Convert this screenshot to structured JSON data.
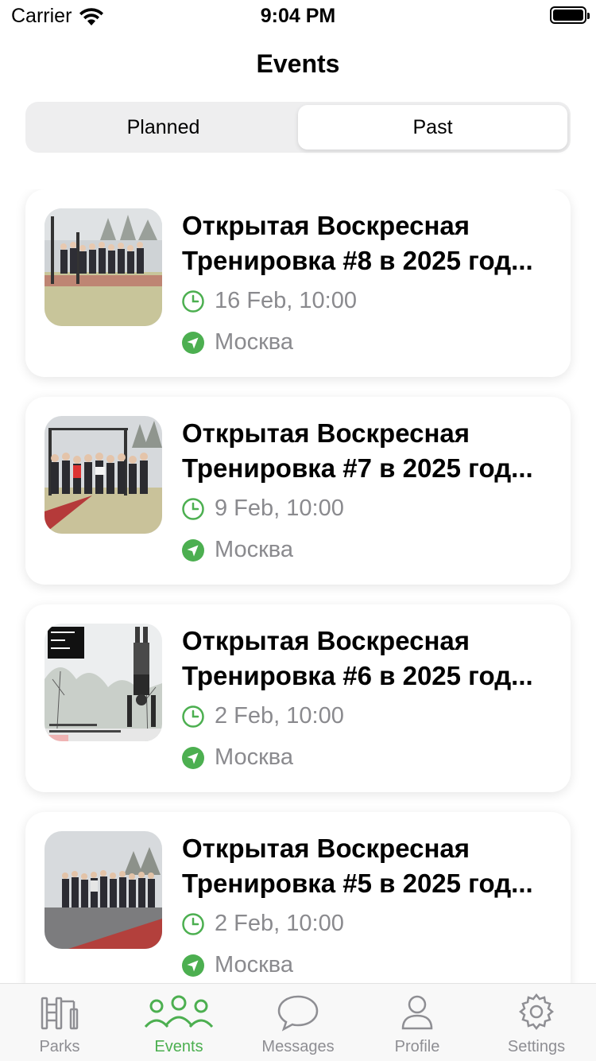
{
  "status_bar": {
    "carrier": "Carrier",
    "time": "9:04 PM"
  },
  "nav": {
    "title": "Events"
  },
  "segmented": {
    "planned": "Planned",
    "past": "Past",
    "selected": "Past"
  },
  "events": [
    {
      "title": "Открытая Воскресная\nТренировка #8 в 2025 год...",
      "date": "16 Feb, 10:00",
      "place": "Москва"
    },
    {
      "title": "Открытая Воскресная\nТренировка #7 в 2025 год...",
      "date": "9 Feb, 10:00",
      "place": "Москва"
    },
    {
      "title": "Открытая Воскресная\nТренировка #6 в 2025 год...",
      "date": "2 Feb, 10:00",
      "place": "Москва"
    },
    {
      "title": "Открытая Воскресная\nТренировка #5 в 2025 год...",
      "date": "2 Feb, 10:00",
      "place": "Москва"
    }
  ],
  "tab_bar": {
    "active": "Events",
    "items": [
      {
        "label": "Parks",
        "icon": "parks-icon"
      },
      {
        "label": "Events",
        "icon": "events-icon"
      },
      {
        "label": "Messages",
        "icon": "messages-icon"
      },
      {
        "label": "Profile",
        "icon": "profile-icon"
      },
      {
        "label": "Settings",
        "icon": "settings-icon"
      }
    ]
  },
  "colors": {
    "accent": "#4caf50",
    "secondary_text": "#8a8a8e",
    "tab_inactive": "#8e8e93"
  }
}
